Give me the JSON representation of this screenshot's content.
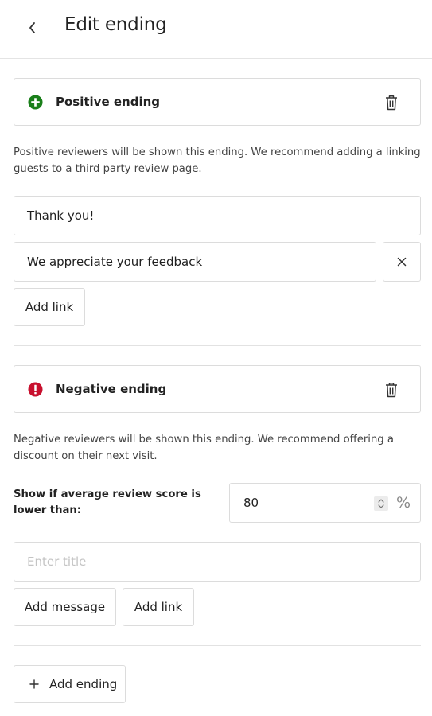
{
  "header": {
    "title": "Edit ending",
    "back_icon": "chevron-left-icon"
  },
  "positive": {
    "label": "Positive ending",
    "icon": "plus-circle-icon",
    "icon_color": "#1a7f1a",
    "description": "Positive reviewers will be shown this ending. We recommend adding a linking guests to a third party review page.",
    "title_value": "Thank you!",
    "message_value": "We appreciate your feedback",
    "add_link_label": "Add link"
  },
  "negative": {
    "label": "Negative ending",
    "icon": "exclamation-circle-icon",
    "icon_color": "#c8102e",
    "description": "Negative reviewers will be shown this ending. We recommend offering a discount on their next visit.",
    "threshold_label": "Show if average review score is lower than:",
    "threshold_value": "80",
    "threshold_unit": "%",
    "title_placeholder": "Enter title",
    "add_message_label": "Add message",
    "add_link_label": "Add link"
  },
  "footer": {
    "add_ending_label": "Add ending"
  }
}
